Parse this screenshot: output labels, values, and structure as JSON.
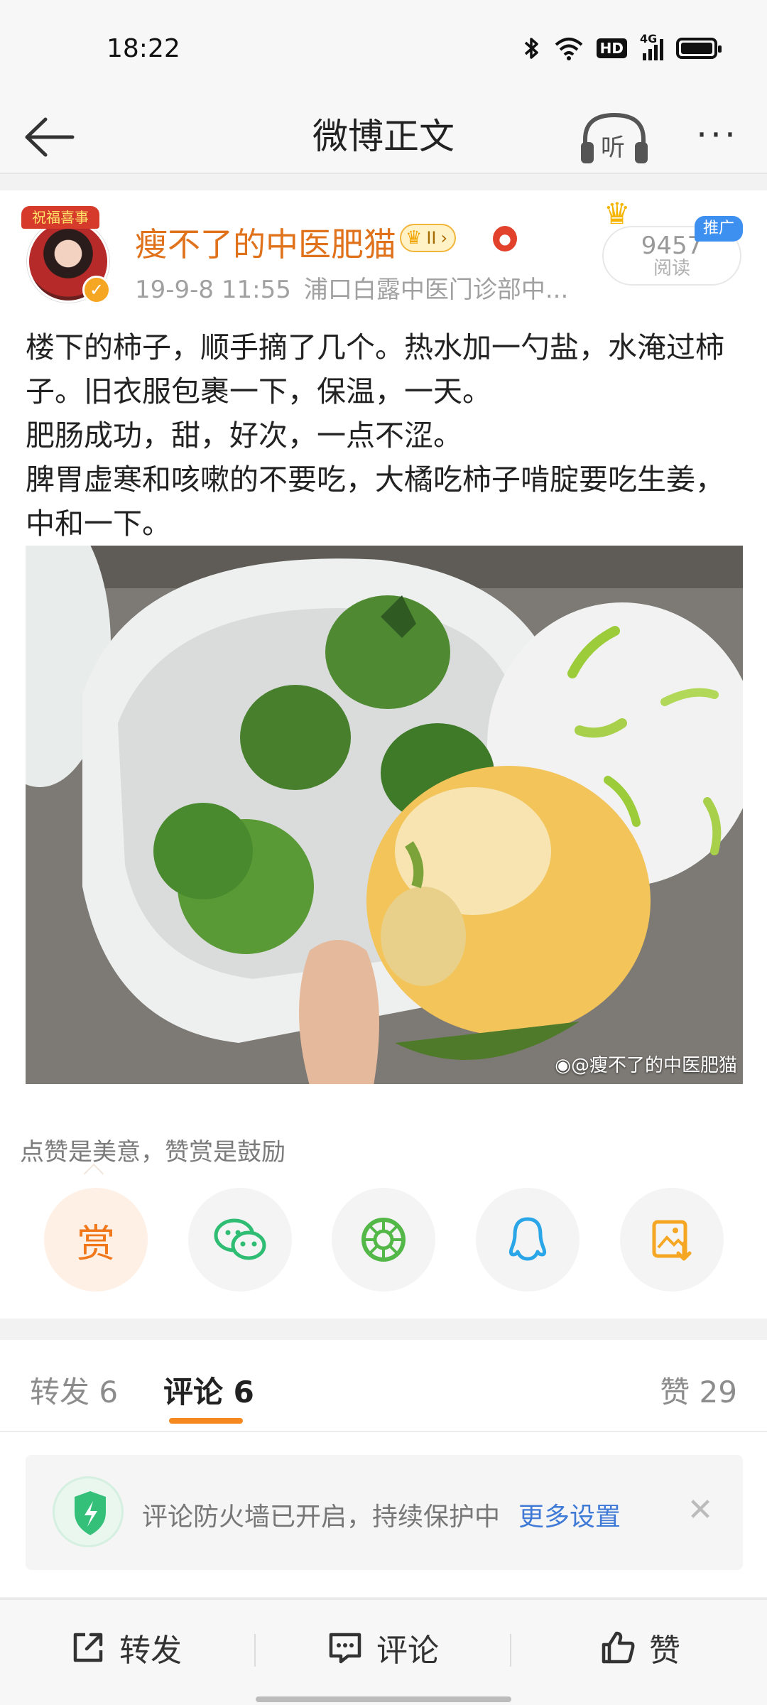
{
  "status_bar": {
    "time": "18:22",
    "icons": [
      "bluetooth-icon",
      "wifi-icon",
      "hd-icon",
      "4g-signal-icon",
      "battery-icon"
    ],
    "hd_label": "HD",
    "network_label": "4G"
  },
  "top_bar": {
    "title": "微博正文",
    "listen_label": "听",
    "back_icon": "back-arrow-icon",
    "more_icon": "more-dots-icon"
  },
  "post": {
    "avatar_badge": "祝福喜事",
    "username": "瘦不了的中医肥猫",
    "vip_level": "II",
    "timestamp": "19-9-8 11:55",
    "location": "浦口白露中医门诊部中...",
    "read_count": "9457",
    "read_label": "阅读",
    "ad_tag": "推广",
    "text_lines": [
      "楼下的柿子，顺手摘了几个。热水加一勺盐，水淹过柿子。旧衣服包裹一下，保温，一天。",
      "肥肠成功，甜，好次，一点不涩。",
      "脾胃虚寒和咳嗽的不要吃，大橘吃柿子啃腚要吃生姜，中和一下。"
    ],
    "photo_watermark": "@瘦不了的中医肥猫"
  },
  "reward": {
    "tip": "点赞是美意，赞赏是鼓励",
    "reward_label": "赏",
    "share_icons": [
      "reward-icon",
      "wechat-icon",
      "moments-icon",
      "qq-icon",
      "save-image-icon"
    ]
  },
  "tabs": {
    "repost": "转发 6",
    "comment": "评论 6",
    "like": "赞 29"
  },
  "firewall": {
    "text": "评论防火墙已开启，持续保护中",
    "link": "更多设置"
  },
  "bottom_bar": {
    "repost": "转发",
    "comment": "评论",
    "like": "赞"
  },
  "colors": {
    "accent_orange": "#f5891f",
    "username_orange": "#e0721c",
    "link_blue": "#3f7ad6",
    "wechat_green": "#2ebd73",
    "qq_blue": "#2aa6e8",
    "save_orange": "#f5a623"
  }
}
